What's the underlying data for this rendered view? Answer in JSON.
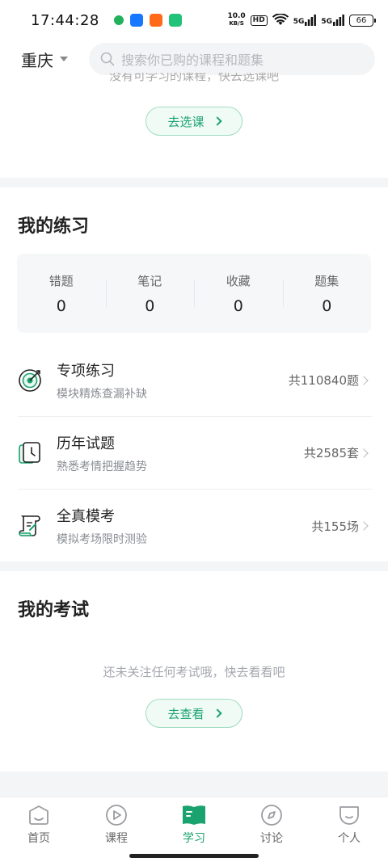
{
  "status_bar": {
    "time": "17:44:28",
    "net_speed_value": "10.0",
    "net_speed_unit": "KB/S",
    "hd_label": "HD",
    "signal_1": "5G",
    "signal_2": "5G",
    "battery": "66"
  },
  "header": {
    "city": "重庆",
    "search_placeholder": "搜索你已购的课程和题集"
  },
  "top_section": {
    "cutoff_text": "没有可学习的课程，快去选课吧",
    "button_label": "去选课"
  },
  "practice": {
    "title": "我的练习",
    "stats": [
      {
        "label": "错题",
        "value": "0"
      },
      {
        "label": "笔记",
        "value": "0"
      },
      {
        "label": "收藏",
        "value": "0"
      },
      {
        "label": "题集",
        "value": "0"
      }
    ],
    "items": [
      {
        "title": "专项练习",
        "subtitle": "模块精炼查漏补缺",
        "count": "共110840题",
        "icon": "target-icon"
      },
      {
        "title": "历年试题",
        "subtitle": "熟悉考情把握趋势",
        "count": "共2585套",
        "icon": "clock-book-icon"
      },
      {
        "title": "全真模考",
        "subtitle": "模拟考场限时测验",
        "count": "共155场",
        "icon": "scroll-icon"
      }
    ]
  },
  "exam": {
    "title": "我的考试",
    "empty_text": "还未关注任何考试哦，快去看看吧",
    "button_label": "去查看"
  },
  "bottom_nav": {
    "items": [
      {
        "label": "首页",
        "icon": "home-icon"
      },
      {
        "label": "课程",
        "icon": "play-icon"
      },
      {
        "label": "学习",
        "icon": "book-icon"
      },
      {
        "label": "讨论",
        "icon": "compass-icon"
      },
      {
        "label": "个人",
        "icon": "smile-icon"
      }
    ],
    "active_index": 2
  },
  "colors": {
    "accent": "#1aa36f",
    "accent_light": "#f1fbf6",
    "page_bg": "#f4f5f7"
  }
}
